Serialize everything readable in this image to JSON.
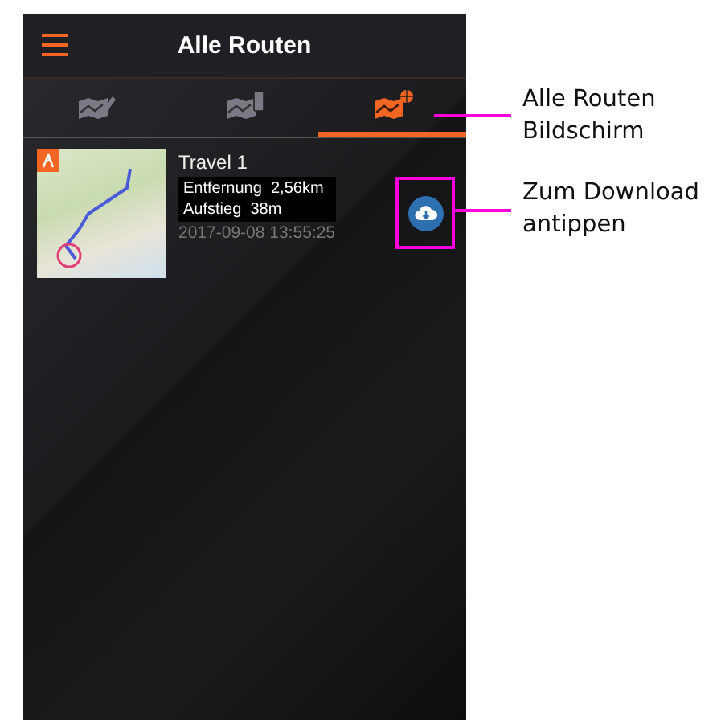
{
  "header": {
    "title": "Alle Routen"
  },
  "tabs": [
    {
      "kind": "edit",
      "selected": false
    },
    {
      "kind": "phone",
      "selected": false
    },
    {
      "kind": "globe",
      "selected": true
    }
  ],
  "routes": [
    {
      "name": "Travel 1",
      "distance_label": "Entfernung",
      "distance": "2,56km",
      "ascent_label": "Aufstieg",
      "ascent": "38m",
      "date": "2017-09-08 13:55:25"
    }
  ],
  "callouts": [
    {
      "text": "Alle Routen\nBildschirm"
    },
    {
      "text": "Zum Download\nantippen"
    }
  ]
}
